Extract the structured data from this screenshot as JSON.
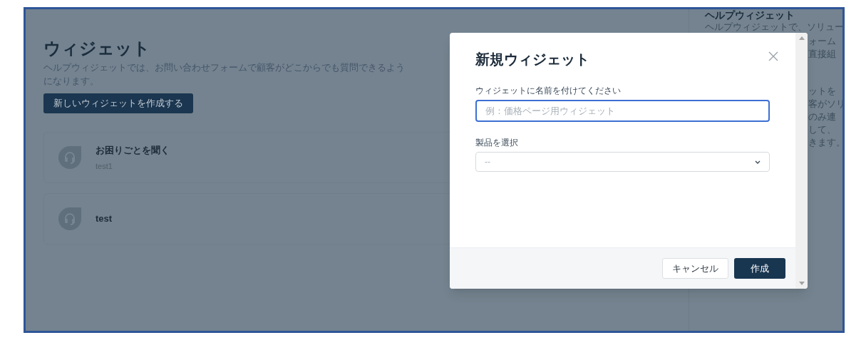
{
  "page": {
    "title": "ウィジェット",
    "description": "ヘルプウィジェットでは、お問い合わせフォームで顧客がどこからでも質問できるようになります。",
    "create_button": "新しいウィジェットを作成する"
  },
  "widgets": [
    {
      "name": "お困りごとを聞く",
      "subtitle": "test1"
    },
    {
      "name": "test"
    }
  ],
  "side_panel": {
    "title": "ヘルプウィジェット",
    "paragraphs": [
      [
        "ヘルプウィジェットで、ソリュー",
        "ォーム",
        "直接組"
      ],
      [
        "ットを",
        "客がソリ",
        "のみ連",
        "して、",
        "きます。"
      ]
    ]
  },
  "modal": {
    "title": "新規ウィジェット",
    "fields": [
      {
        "kind": "text",
        "label": "ウィジェットに名前を付けてください",
        "placeholder": "例：価格ページ用ウィジェット",
        "focused": true
      },
      {
        "kind": "select",
        "label": "製品を選択",
        "value": "--"
      }
    ],
    "buttons": [
      {
        "kind": "secondary",
        "label": "キャンセル"
      },
      {
        "kind": "primary",
        "label": "作成"
      }
    ]
  }
}
